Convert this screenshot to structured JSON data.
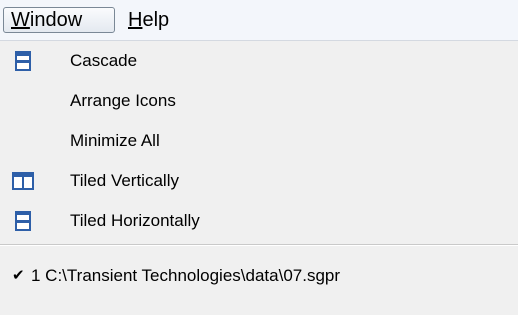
{
  "menubar": {
    "items": [
      {
        "label": "Window",
        "accel": "W",
        "rest": "indow",
        "active": true
      },
      {
        "label": "Help",
        "accel": "H",
        "rest": "elp",
        "active": false
      }
    ]
  },
  "dropdown": {
    "items": [
      {
        "label": "Cascade",
        "icon": "cascade-window-icon"
      },
      {
        "label": "Arrange Icons",
        "icon": null
      },
      {
        "label": "Minimize All",
        "icon": null
      },
      {
        "label": "Tiled Vertically",
        "icon": "tile-vertical-icon"
      },
      {
        "label": "Tiled Horizontally",
        "icon": "tile-horizontal-icon"
      }
    ],
    "recent": {
      "checked": true,
      "check_glyph": "✔",
      "label": "1 C:\\Transient Technologies\\data\\07.sgpr"
    }
  },
  "colors": {
    "icon_blue": "#2e5fa8",
    "menubar_bg": "#f3f6fb",
    "menu_bg": "#f0f0f0"
  }
}
